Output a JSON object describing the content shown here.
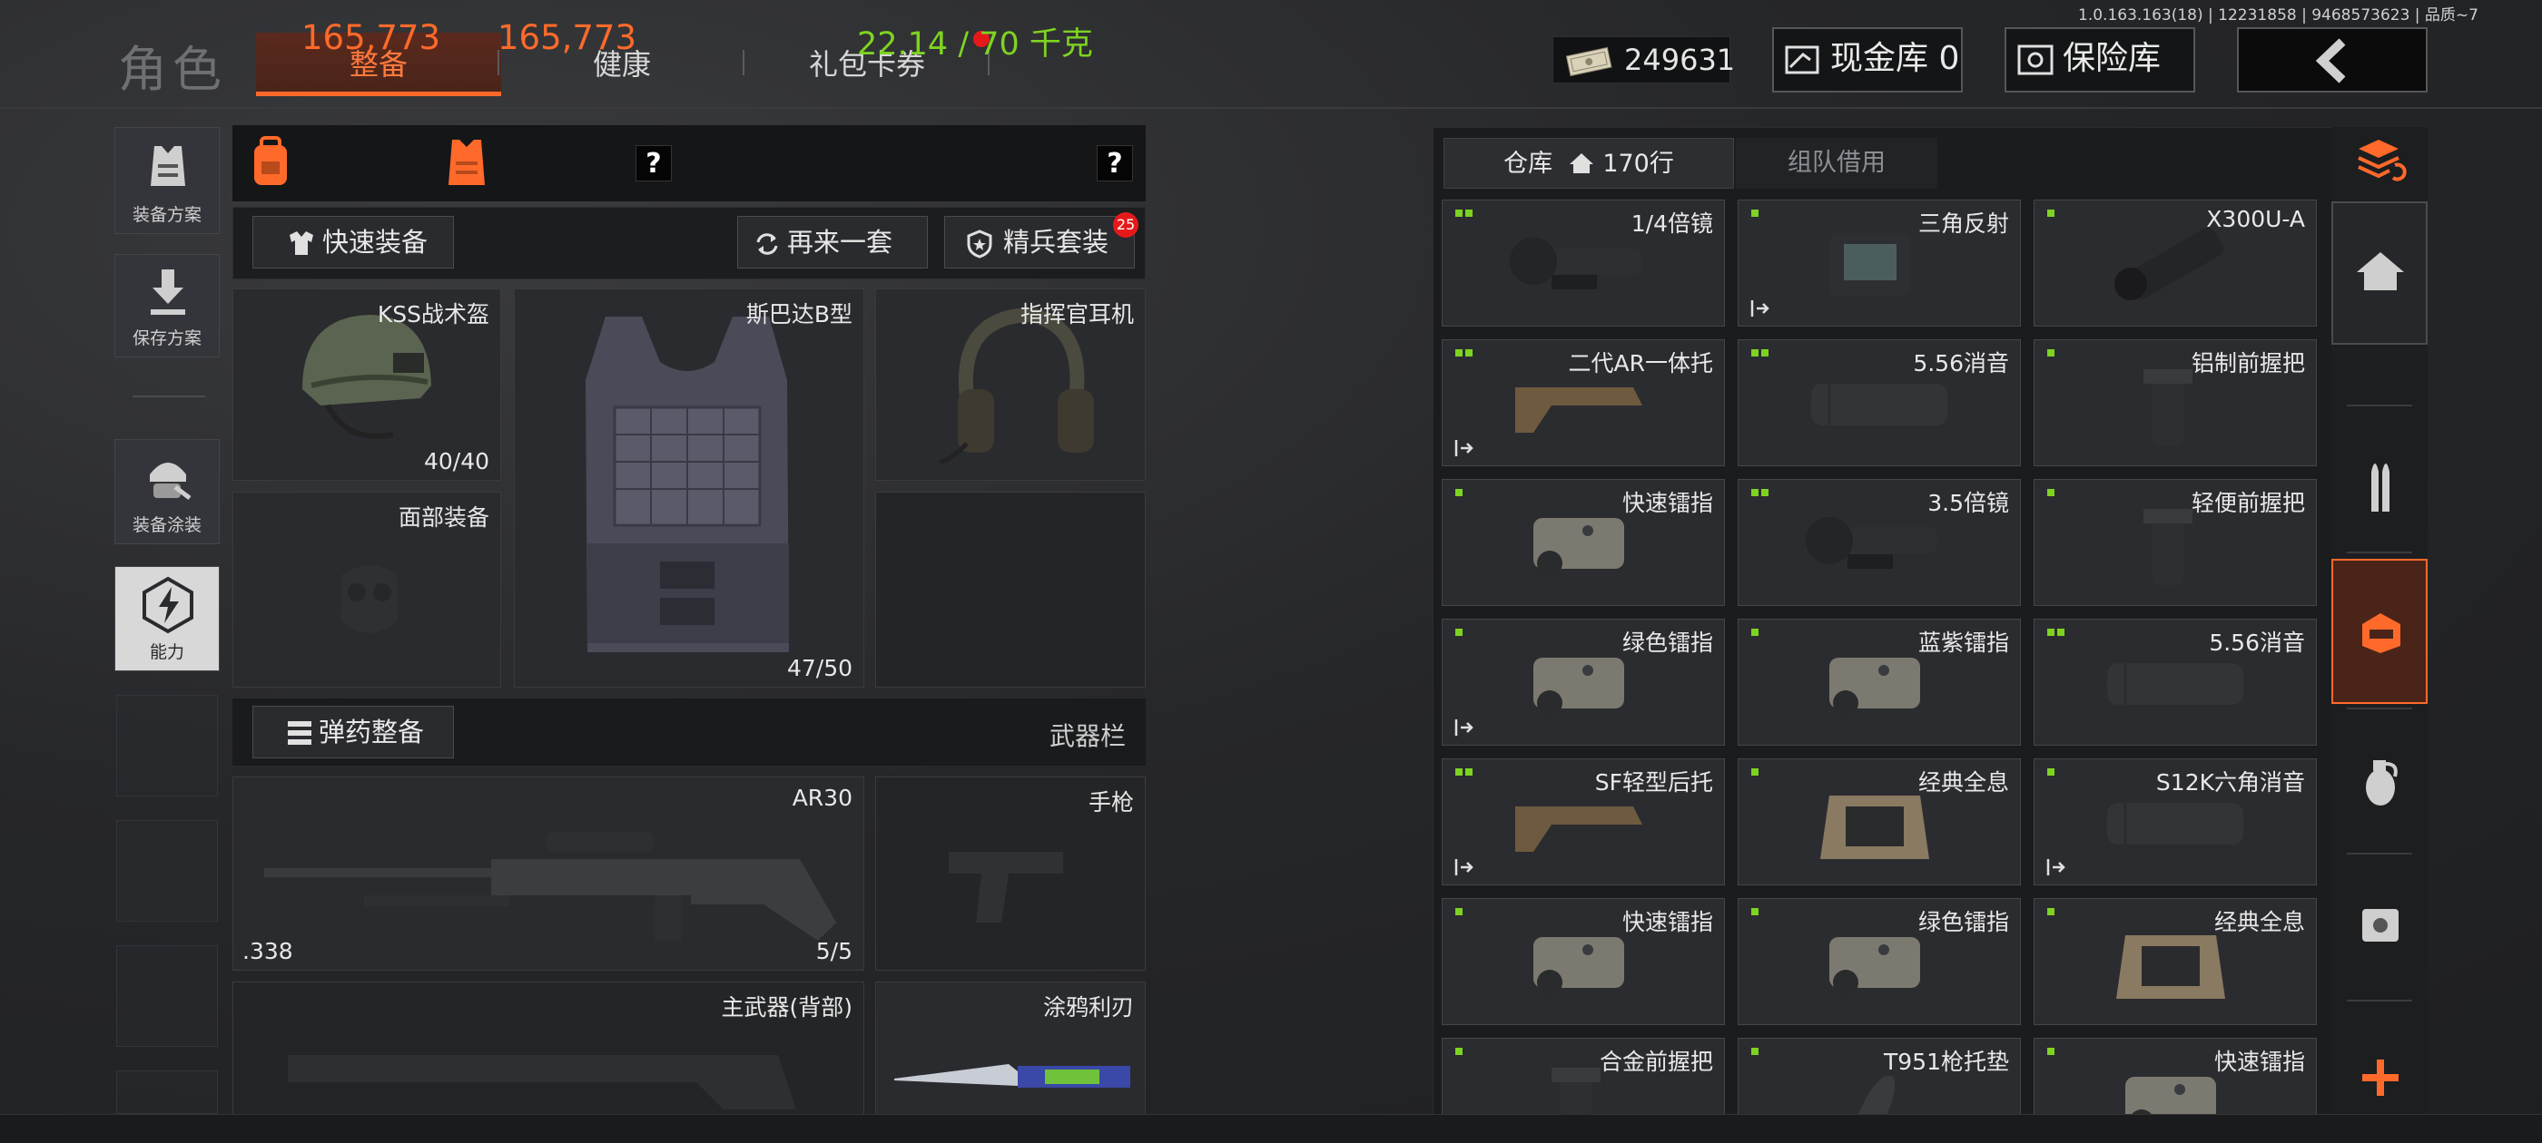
{
  "header": {
    "title": "角色",
    "tabs": [
      {
        "label": "整备",
        "active": true
      },
      {
        "label": "健康",
        "active": false
      },
      {
        "label": "礼包卡券",
        "active": false,
        "notification": true
      }
    ],
    "version": "1.0.163.163(18) | 12231858 | 9468573623 | 品质~7",
    "cash": "249631",
    "cash_vault_label": "现金库 0",
    "safe_label": "保险库"
  },
  "sidebar": {
    "items": [
      {
        "label": "装备方案",
        "icon": "vest-icon"
      },
      {
        "label": "保存方案",
        "icon": "download-icon"
      },
      {
        "label": "装备涂装",
        "icon": "helmet-paint-icon"
      },
      {
        "label": "能力",
        "icon": "lightning-icon"
      }
    ]
  },
  "stats": {
    "value1": "165,773",
    "value2": "165,773",
    "weight": "22.14 / 70 千克",
    "help": "?"
  },
  "toolbar": {
    "quick_equip": "快速装备",
    "again": "再来一套",
    "elite": "精兵套装",
    "elite_badge": "25"
  },
  "gear": {
    "helmet": {
      "name": "KSS战术盔",
      "durability": "40/40"
    },
    "armor": {
      "name": "斯巴达B型",
      "durability": "47/50"
    },
    "headset": {
      "name": "指挥官耳机"
    },
    "face": {
      "name": "面部装备"
    }
  },
  "weapons": {
    "ammo_button": "弹药整备",
    "bar_label": "武器栏",
    "primary": {
      "name": "AR30",
      "caliber": ".338",
      "ammo": "5/5"
    },
    "pistol": {
      "name": "手枪"
    },
    "back": {
      "name": "主武器(背部)"
    },
    "melee": {
      "name": "涂鸦利刃"
    }
  },
  "storage": {
    "tab_warehouse": "仓库",
    "rows": "170行",
    "tab_team": "组队借用",
    "items": [
      {
        "name": "1/4倍镜",
        "pips": 2,
        "exit": false,
        "icon": "scope-icon"
      },
      {
        "name": "三角反射",
        "pips": 1,
        "exit": true,
        "icon": "red-dot-sight-icon"
      },
      {
        "name": "X300U-A",
        "pips": 1,
        "exit": false,
        "icon": "flashlight-icon"
      },
      {
        "name": "二代AR一体托",
        "pips": 2,
        "exit": true,
        "icon": "stock-icon"
      },
      {
        "name": "5.56消音",
        "pips": 2,
        "exit": false,
        "icon": "suppressor-icon"
      },
      {
        "name": "铝制前握把",
        "pips": 1,
        "exit": false,
        "icon": "foregrip-icon"
      },
      {
        "name": "快速镭指",
        "pips": 1,
        "exit": false,
        "icon": "laser-icon"
      },
      {
        "name": "3.5倍镜",
        "pips": 2,
        "exit": false,
        "icon": "scope-icon"
      },
      {
        "name": "轻便前握把",
        "pips": 1,
        "exit": false,
        "icon": "foregrip-icon"
      },
      {
        "name": "绿色镭指",
        "pips": 1,
        "exit": true,
        "icon": "laser-icon"
      },
      {
        "name": "蓝紫镭指",
        "pips": 1,
        "exit": false,
        "icon": "laser-icon"
      },
      {
        "name": "5.56消音",
        "pips": 2,
        "exit": false,
        "icon": "suppressor-icon"
      },
      {
        "name": "SF轻型后托",
        "pips": 2,
        "exit": true,
        "icon": "stock-icon"
      },
      {
        "name": "经典全息",
        "pips": 1,
        "exit": false,
        "icon": "holo-sight-icon"
      },
      {
        "name": "S12K六角消音",
        "pips": 1,
        "exit": true,
        "icon": "suppressor-icon"
      },
      {
        "name": "快速镭指",
        "pips": 1,
        "exit": false,
        "icon": "laser-icon"
      },
      {
        "name": "绿色镭指",
        "pips": 1,
        "exit": false,
        "icon": "laser-icon"
      },
      {
        "name": "经典全息",
        "pips": 1,
        "exit": false,
        "icon": "holo-sight-icon"
      },
      {
        "name": "合金前握把",
        "pips": 1,
        "exit": false,
        "icon": "foregrip-icon"
      },
      {
        "name": "T951枪托垫",
        "pips": 1,
        "exit": false,
        "icon": "buttpad-icon"
      },
      {
        "name": "快速镭指",
        "pips": 1,
        "exit": false,
        "icon": "laser-icon"
      }
    ]
  },
  "categories": [
    {
      "icon": "home-icon"
    },
    {
      "icon": "ammo-icon"
    },
    {
      "icon": "attachment-icon",
      "active": true
    },
    {
      "icon": "grenade-icon"
    },
    {
      "icon": "container-icon"
    },
    {
      "icon": "add-icon"
    }
  ],
  "colors": {
    "accent": "#ff6a2a",
    "weight": "#7ed321",
    "badge": "#e5191a"
  }
}
